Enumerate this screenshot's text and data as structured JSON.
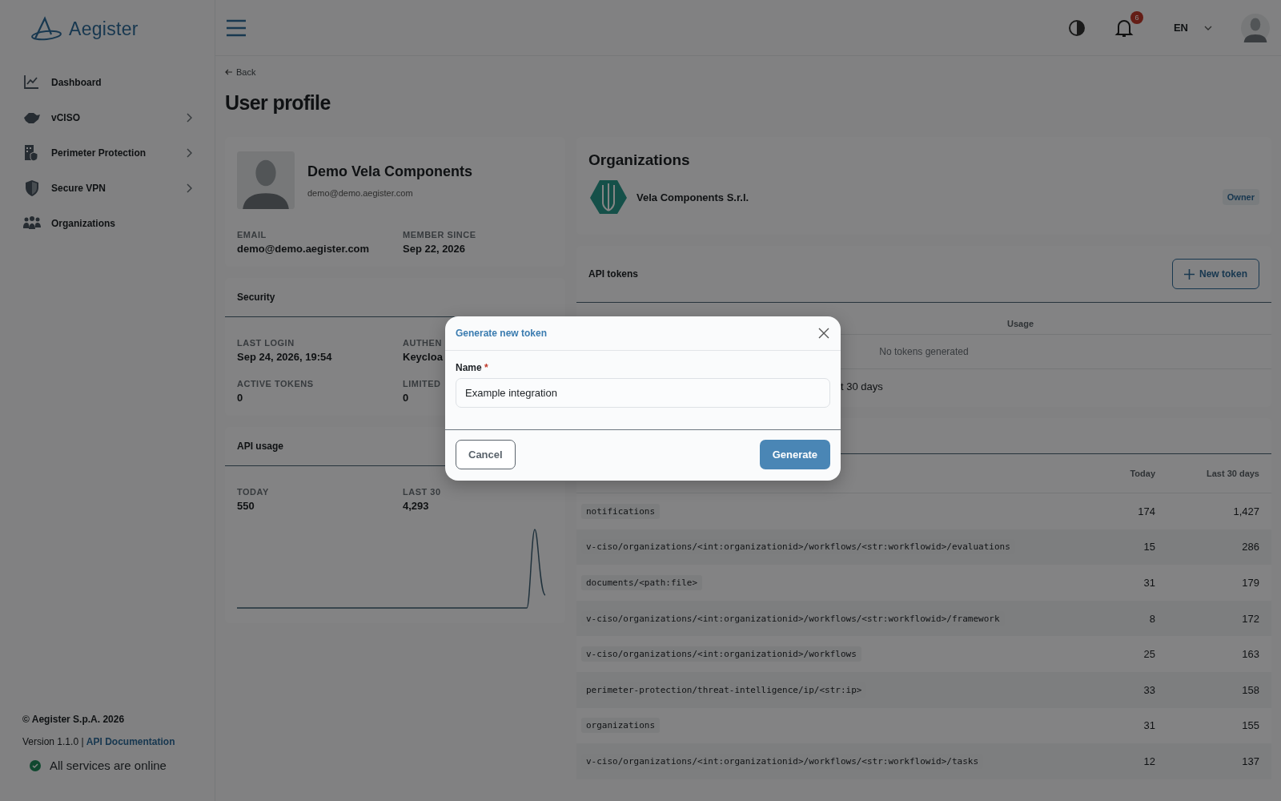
{
  "sidebar": {
    "logo": "Aegister",
    "items": [
      {
        "label": "Dashboard",
        "expandable": false
      },
      {
        "label": "vCISO",
        "expandable": true
      },
      {
        "label": "Perimeter Protection",
        "expandable": true
      },
      {
        "label": "Secure VPN",
        "expandable": true
      },
      {
        "label": "Organizations",
        "expandable": false
      }
    ],
    "copyright": "© Aegister S.p.A. 2026",
    "version": "Version 1.1.0 |",
    "docs_link": "API Documentation",
    "status": "All services are online"
  },
  "header": {
    "notification_count": "6",
    "language": "EN"
  },
  "page": {
    "back": "Back",
    "title": "User profile"
  },
  "profile": {
    "name": "Demo Vela Components",
    "email": "demo@demo.aegister.com",
    "fields": [
      {
        "label": "EMAIL",
        "value": "demo@demo.aegister.com"
      },
      {
        "label": "MEMBER SINCE",
        "value": "Sep 22, 2026"
      }
    ]
  },
  "security": {
    "title": "Security",
    "fields": [
      {
        "label": "LAST LOGIN",
        "value": "Sep 24, 2026, 19:54"
      },
      {
        "label": "AUTHEN",
        "value": "Keycloa"
      },
      {
        "label": "ACTIVE TOKENS",
        "value": "0"
      },
      {
        "label": "LIMITED",
        "value": "0"
      }
    ]
  },
  "api_usage": {
    "title": "API usage",
    "fields": [
      {
        "label": "TODAY",
        "value": "550"
      },
      {
        "label": "LAST 30",
        "value": "4,293"
      }
    ]
  },
  "organizations": {
    "title": "Organizations",
    "items": [
      {
        "name": "Vela Components S.r.l.",
        "role": "Owner"
      }
    ]
  },
  "api_tokens": {
    "title": "API tokens",
    "new_button": "New token",
    "columns": [
      "Usage"
    ],
    "empty": "No tokens generated",
    "footer": "t 30 days"
  },
  "endpoints": {
    "columns": [
      "Today",
      "Last 30 days"
    ],
    "rows": [
      {
        "path": "notifications",
        "today": "174",
        "last_30_days": "1,427"
      },
      {
        "path": "v-ciso/organizations/<int:organizationid>/workflows/<str:workflowid>/evaluations",
        "today": "15",
        "last_30_days": "286"
      },
      {
        "path": "documents/<path:file>",
        "today": "31",
        "last_30_days": "179"
      },
      {
        "path": "v-ciso/organizations/<int:organizationid>/workflows/<str:workflowid>/framework",
        "today": "8",
        "last_30_days": "172"
      },
      {
        "path": "v-ciso/organizations/<int:organizationid>/workflows",
        "today": "25",
        "last_30_days": "163"
      },
      {
        "path": "perimeter-protection/threat-intelligence/ip/<str:ip>",
        "today": "33",
        "last_30_days": "158"
      },
      {
        "path": "organizations",
        "today": "31",
        "last_30_days": "155"
      },
      {
        "path": "v-ciso/organizations/<int:organizationid>/workflows/<str:workflowid>/tasks",
        "today": "12",
        "last_30_days": "137"
      }
    ]
  },
  "modal": {
    "title": "Generate new token",
    "field_label": "Name",
    "required_mark": "*",
    "field_value": "Example integration",
    "cancel": "Cancel",
    "confirm": "Generate"
  }
}
